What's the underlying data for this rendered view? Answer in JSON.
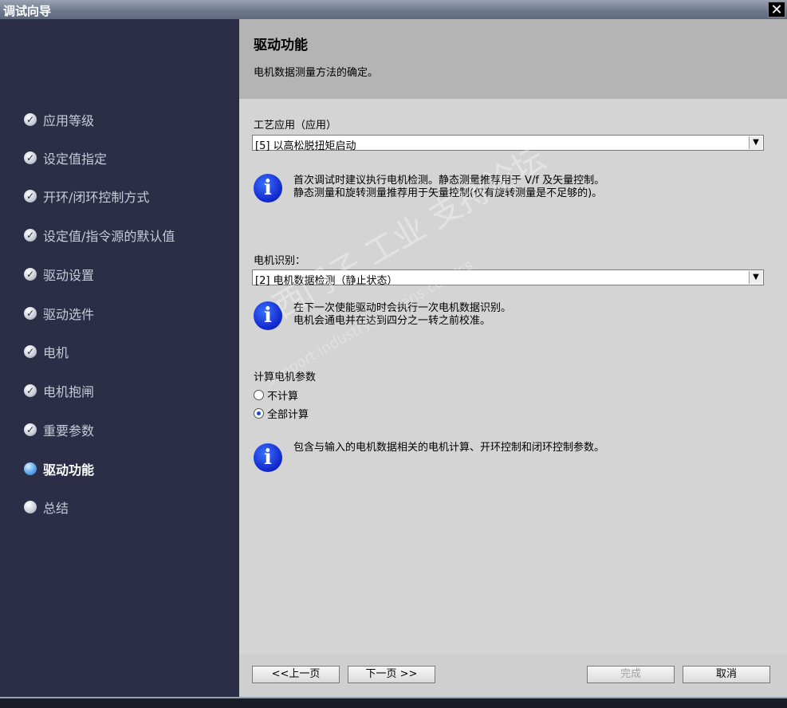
{
  "window": {
    "title": "调试向导",
    "close_glyph": "✕"
  },
  "sidebar": {
    "items": [
      {
        "label": "应用等级",
        "state": "done"
      },
      {
        "label": "设定值指定",
        "state": "done"
      },
      {
        "label": "开环/闭环控制方式",
        "state": "done"
      },
      {
        "label": "设定值/指令源的默认值",
        "state": "done"
      },
      {
        "label": "驱动设置",
        "state": "done"
      },
      {
        "label": "驱动选件",
        "state": "done"
      },
      {
        "label": "电机",
        "state": "done"
      },
      {
        "label": "电机抱闸",
        "state": "done"
      },
      {
        "label": "重要参数",
        "state": "done"
      },
      {
        "label": "驱动功能",
        "state": "active"
      },
      {
        "label": "总结",
        "state": "pending"
      }
    ]
  },
  "header": {
    "title": "驱动功能",
    "subtitle": "电机数据测量方法的确定。"
  },
  "tech_app": {
    "label": "工艺应用（应用）",
    "value": "[5] 以高松脱扭矩启动",
    "info_line1": "首次调试时建议执行电机检测。静态测量推荐用于 V/f 及矢量控制。",
    "info_line2": "静态测量和旋转测量推荐用于矢量控制(仅有旋转测量是不足够的)。"
  },
  "motor_id": {
    "label": "电机识别：",
    "value": "[2] 电机数据检测（静止状态）",
    "info_line1": "在下一次使能驱动时会执行一次电机数据识别。",
    "info_line2": "电机会通电并在达到四分之一转之前校准。"
  },
  "calc": {
    "label": "计算电机参数",
    "options": [
      {
        "label": "不计算",
        "selected": false
      },
      {
        "label": "全部计算",
        "selected": true
      }
    ],
    "info_line1": "包含与输入的电机数据相关的电机计算、开环控制和闭环控制参数。"
  },
  "footer": {
    "prev": "<<上一页",
    "next": "下一页 >>",
    "finish": "完成",
    "cancel": "取消"
  },
  "watermark": {
    "line1": "西门子 工业 支持论坛",
    "line2": "support.industry.siemens.com/cs"
  },
  "icons": {
    "info": "info-icon",
    "check": "check-icon",
    "dropdown": "chevron-down-icon"
  },
  "colors": {
    "sidebar_bg": "#2b2e46",
    "header_bg": "#b4b4b4",
    "content_bg": "#d4d4d4",
    "info_blue": "#1026c9",
    "active_bullet": "#2a6fc3"
  }
}
